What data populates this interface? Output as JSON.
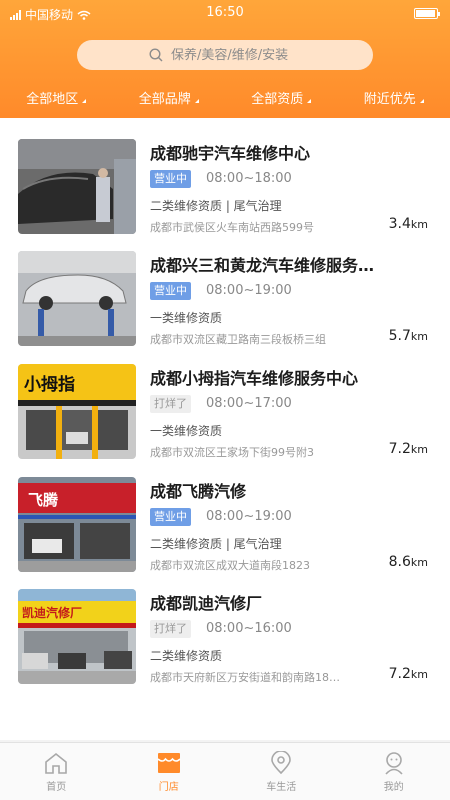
{
  "status_bar": {
    "carrier": "中国移动",
    "time": "16:50"
  },
  "search": {
    "placeholder": "保养/美容/维修/安装"
  },
  "filters": [
    "全部地区",
    "全部品牌",
    "全部资质",
    "附近优先"
  ],
  "shops": [
    {
      "name": "成都驰宇汽车维修中心",
      "status": "营业中",
      "status_type": "open",
      "hours": "08:00~18:00",
      "qualification": "二类维修资质 | 尾气治理",
      "address": "成都市武侯区火车南站西路599号",
      "distance": "3.4",
      "unit": "km"
    },
    {
      "name": "成都兴三和黄龙汽车维修服务…",
      "status": "营业中",
      "status_type": "open",
      "hours": "08:00~19:00",
      "qualification": "一类维修资质",
      "address": "成都市双流区藏卫路南三段板桥三组",
      "distance": "5.7",
      "unit": "km"
    },
    {
      "name": "成都小拇指汽车维修服务中心",
      "status": "打烊了",
      "status_type": "closed",
      "hours": "08:00~17:00",
      "qualification": "一类维修资质",
      "address": "成都市双流区王家场下街99号附3",
      "distance": "7.2",
      "unit": "km"
    },
    {
      "name": "成都飞腾汽修",
      "status": "营业中",
      "status_type": "open",
      "hours": "08:00~19:00",
      "qualification": "二类维修资质 | 尾气治理",
      "address": "成都市双流区成双大道南段1823",
      "distance": "8.6",
      "unit": "km"
    },
    {
      "name": "成都凯迪汽修厂",
      "status": "打烊了",
      "status_type": "closed",
      "hours": "08:00~16:00",
      "qualification": "二类维修资质",
      "address": "成都市天府新区万安街道和韵南路18…",
      "distance": "7.2",
      "unit": "km"
    }
  ],
  "thumb_signs": [
    "",
    "",
    "小拇指",
    "飞腾",
    "凯迪汽修厂"
  ],
  "tabs": [
    {
      "label": "首页",
      "icon": "home-icon",
      "active": false
    },
    {
      "label": "门店",
      "icon": "store-icon",
      "active": true
    },
    {
      "label": "车生活",
      "icon": "location-pin-icon",
      "active": false
    },
    {
      "label": "我的",
      "icon": "profile-icon",
      "active": false
    }
  ],
  "colors": {
    "accent": "#ff8a2a",
    "open_badge": "#6f9ee6",
    "closed_badge": "#eeeeee"
  }
}
